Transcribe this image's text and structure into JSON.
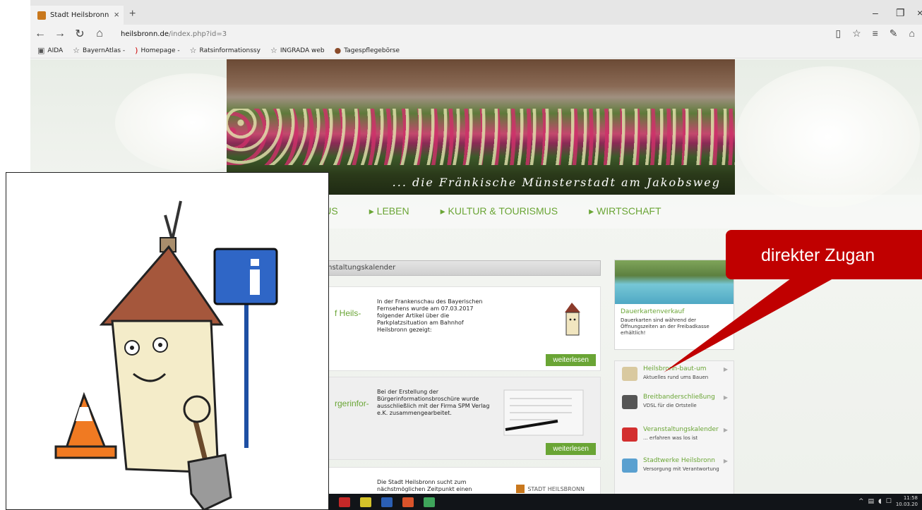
{
  "browser": {
    "tab_title": "Stadt Heilsbronn | Starts",
    "url_host": "heilsbronn.de",
    "url_path": "/index.php?id=3",
    "new_tab_label": "+",
    "tab_close_label": "×",
    "icons": [
      "back-icon",
      "forward-icon",
      "refresh-icon",
      "home-icon",
      "reading-view-icon",
      "favorite-star-icon",
      "hub-icon",
      "note-icon",
      "share-icon"
    ],
    "window_controls": [
      "–",
      "❐",
      "×"
    ]
  },
  "favorites": [
    {
      "label": "AIDA",
      "icon": "map-icon"
    },
    {
      "label": "BayernAtlas -",
      "icon": "star-icon"
    },
    {
      "label": "Homepage -",
      "icon": "bookmark-icon"
    },
    {
      "label": "Ratsinformationssy",
      "icon": "star-icon"
    },
    {
      "label": "INGRADA web",
      "icon": "star-icon"
    },
    {
      "label": "Tagespflegebörse",
      "icon": "bookmark-icon"
    }
  ],
  "banner": {
    "slogan": "... die Fränkische Münsterstadt am Jakobsweg"
  },
  "main_nav": [
    {
      "label": "ATHAUS"
    },
    {
      "label": "▸ LEBEN"
    },
    {
      "label": "▸ KULTUR & TOURISMUS"
    },
    {
      "label": "▸ WIRTSCHAFT"
    }
  ],
  "section": {
    "header": "anstaltungskalender"
  },
  "news": [
    {
      "title": "f Heils-",
      "text": "In der Frankenschau des Bayerischen Fernsehens wurde am 07.03.2017 folgender Artikel über die Parkplatzsituation am Bahnhof Heilsbronn gezeigt:",
      "more": "weiterlesen"
    },
    {
      "title": "rgerinfor-",
      "text": "Bei der Erstellung der Bürgerinformationsbroschüre wurde ausschließlich mit der Firma SPM Verlag e.K. zusammengearbeitet.",
      "more": "weiterlesen"
    },
    {
      "title": "",
      "text": "Die Stadt Heilsbronn sucht zum nächstmöglichen Zeitpunkt einen",
      "logo_text": "STADT HEILSBRONN"
    }
  ],
  "teaser": {
    "title": "Dauerkartenverkauf",
    "text": "Dauerkarten sind während der Öffnungszeiten an der Freibadkasse erhältlich!"
  },
  "quicklinks": [
    {
      "title": "Heilsbronn-baut-um",
      "sub": "Aktuelles rund ums Bauen",
      "icon": "house-icon",
      "color": "#d9c9a0"
    },
    {
      "title": "Breitbanderschließung",
      "sub": "VDSL für die Ortstelle",
      "icon": "download-icon",
      "color": "#555555"
    },
    {
      "title": "Veranstaltungskalender",
      "sub": "... erfahren was los ist",
      "icon": "calendar-icon",
      "color": "#d32f2f"
    },
    {
      "title": "Stadtwerke Heilsbronn",
      "sub": "Versorgung mit Verantwortung",
      "icon": "waves-icon",
      "color": "#5aa0d0"
    }
  ],
  "callout": {
    "text": "direkter Zugan",
    "color": "#c00000"
  },
  "colors": {
    "accent_green": "#6aa535",
    "callout_red": "#c00000"
  },
  "taskbar": {
    "apps": [
      {
        "name": "pdf-app-icon",
        "color": "#c62828"
      },
      {
        "name": "editor-app-icon",
        "color": "#d4c22a"
      },
      {
        "name": "word-app-icon",
        "color": "#2b5fb4"
      },
      {
        "name": "powerpoint-app-icon",
        "color": "#d9532a"
      },
      {
        "name": "image-app-icon",
        "color": "#3fa55b"
      }
    ],
    "time": "11:58",
    "date": "10.03.20"
  }
}
